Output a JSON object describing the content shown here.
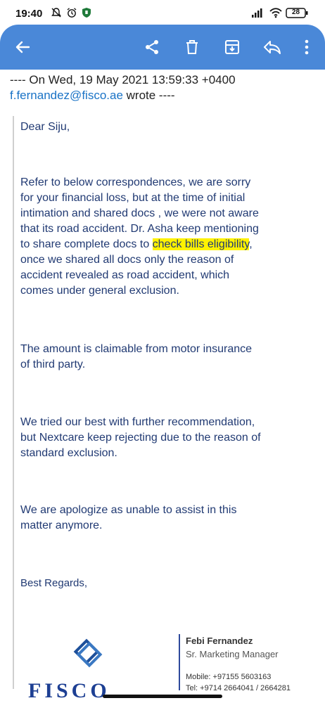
{
  "status": {
    "time": "19:40",
    "battery": "28"
  },
  "email": {
    "header_prefix": "---- On Wed, 19 May 2021 13:59:33 +0400",
    "sender": "f.fernandez@fisco.ae",
    "wrote": " wrote ----",
    "greeting": "Dear Siju,",
    "p1_l1": "Refer to below correspondences, we are sorry",
    "p1_l2": "for your financial loss, but at the time of initial",
    "p1_l3": "intimation and shared docs , we were not aware",
    "p1_l4": "that its road accident. Dr. Asha keep  mentioning",
    "p1_l5_pre": "to share complete docs to ",
    "p1_l5_hl": "check bills eligibility",
    "p1_l5_post": ",",
    "p1_l6": "once we shared all docs only the reason of",
    "p1_l7": "accident revealed as road accident, which",
    "p1_l8": "comes under general exclusion.",
    "p2_l1": "The amount is claimable from motor insurance",
    "p2_l2": "of third party.",
    "p3_l1": "We tried our best with further recommendation,",
    "p3_l2": "but Nextcare keep rejecting due to the reason of",
    "p3_l3": "standard exclusion.",
    "p4_l1": "We are apologize as unable to assist in this",
    "p4_l2": "matter anymore.",
    "closing": "Best Regards,"
  },
  "signature": {
    "name": "Febi Fernandez",
    "title": "Sr. Marketing Manager",
    "mobile": "Mobile: +97155 5603163",
    "tel": "Tel: +9714 2664041 / 2664281",
    "brand": "FISCO"
  },
  "toolbar": {
    "back": "back-arrow-icon",
    "share": "share-icon",
    "delete": "trash-icon",
    "archive": "archive-icon",
    "reply": "reply-icon",
    "more": "more-vert-icon"
  },
  "colors": {
    "appbar": "#4a88d8",
    "link": "#1a73c6",
    "body_text": "#213a73",
    "highlight": "#fff200"
  }
}
